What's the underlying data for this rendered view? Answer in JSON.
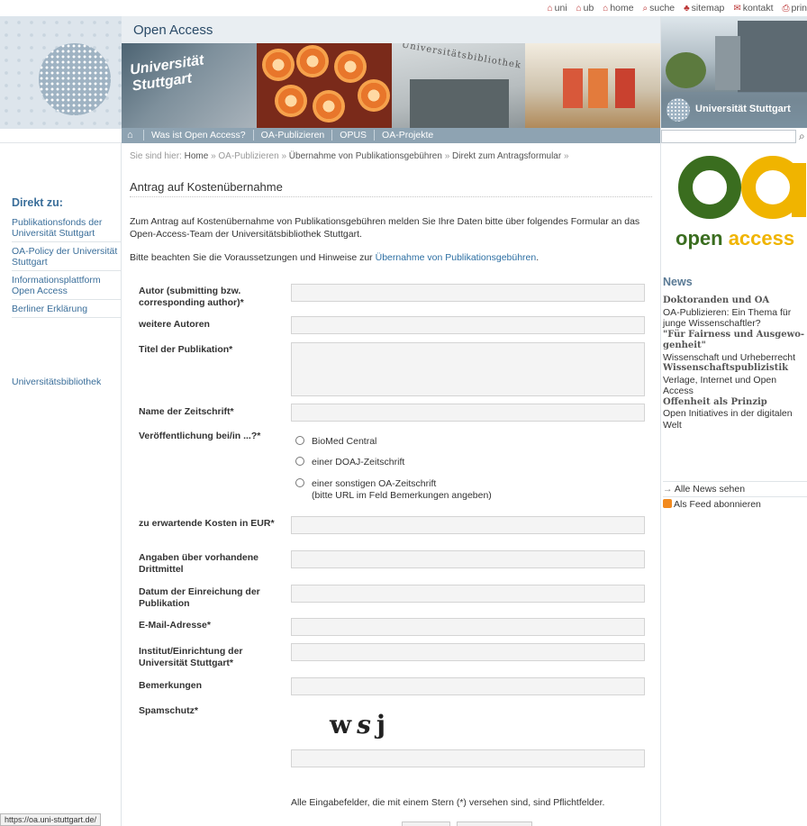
{
  "topbar": {
    "links": [
      {
        "icon": "home-icon",
        "label": "uni"
      },
      {
        "icon": "home-icon",
        "label": "ub"
      },
      {
        "icon": "home-icon",
        "label": "home"
      },
      {
        "icon": "search-icon",
        "label": "suche"
      },
      {
        "icon": "sitemap-icon",
        "label": "sitemap"
      },
      {
        "icon": "mail-icon",
        "label": "kontakt"
      },
      {
        "icon": "print-icon",
        "label": "prin"
      }
    ]
  },
  "header": {
    "title": "Open Access",
    "banner_text": "Universität Stuttgart",
    "banner_sign": "Universitätsbibliothek"
  },
  "nav": {
    "tabs": [
      "Was ist Open Access?",
      "OA-Publizieren",
      "OPUS",
      "OA-Projekte"
    ]
  },
  "breadcrumb": {
    "prefix": "Sie sind hier:",
    "items": [
      "Home",
      "OA-Publizieren",
      "Übernahme von Publikationsgebühren",
      "Direkt zum Antragsformular"
    ],
    "sep": "»"
  },
  "left": {
    "direkt_title": "Direkt zu:",
    "items": [
      "Publikationsfonds der Universität Stuttgart",
      "OA-Policy der Universität Stuttgart",
      "Informationsplattform Open Access",
      "Berliner Erklärung"
    ],
    "ub": "Universitätsbibliothek"
  },
  "main": {
    "title": "Antrag auf Kostenübernahme",
    "intro": "Zum Antrag auf Kostenübernahme von Publikationsgebühren melden Sie Ihre Daten bitte über folgendes Formular an das Open-Access-Team der Universitätsbibliothek Stuttgart.",
    "intro2_prefix": "Bitte beachten Sie die Voraussetzungen und Hinweise zur",
    "intro2_link": "Übernahme von Publikationsgebühren",
    "intro2_suffix": ".",
    "labels": {
      "autor": "Autor (submitting bzw. corresponding author)*",
      "weitere": "weitere Autoren",
      "titel": "Titel der Publikation*",
      "zeitschrift": "Name der Zeitschrift*",
      "veroeff": "Veröffentlichung bei/in ...?*",
      "kosten": "zu erwartende Kosten in EUR*",
      "drittmittel": "Angaben über vorhandene Drittmittel",
      "datum": "Datum der Einreichung der Publikation",
      "email": "E-Mail-Adresse*",
      "institut": "Institut/Einrichtung der Universität Stuttgart*",
      "bemerkungen": "Bemerkungen",
      "spam": "Spamschutz*"
    },
    "radios": [
      {
        "label": "BioMed Central",
        "checked": false
      },
      {
        "label": "einer DOAJ-Zeitschrift",
        "checked": false
      },
      {
        "label": "einer sonstigen OA-Zeitschrift",
        "sub": "(bitte URL im Feld Bemerkungen angeben)",
        "checked": false
      }
    ],
    "captcha": {
      "c1": "w",
      "c2": "s",
      "c3": "j"
    },
    "pflicht": "Alle Eingabefelder, die mit einem Stern (*) versehen sind, sind Pflichtfelder."
  },
  "right": {
    "photo_text": "Universität Stuttgart",
    "oa_open": "open",
    "oa_access": "access",
    "news_title": "News",
    "news": [
      {
        "text": "Doktoranden und OA",
        "bold": true
      },
      {
        "text": "OA-Publizieren: Ein Thema für",
        "bold": false
      },
      {
        "text": "junge Wissenschaftler?",
        "bold": false
      },
      {
        "text": "\"Für Fairness und Ausgewo-",
        "bold": true
      },
      {
        "text": "genheit\"",
        "bold": true
      },
      {
        "text": "Wissenschaft und Urheberrecht",
        "bold": false
      },
      {
        "text": "Wissenschaftspublizistik",
        "bold": true
      },
      {
        "text": "Verlage, Internet und Open",
        "bold": false
      },
      {
        "text": "Access",
        "bold": false
      },
      {
        "text": "Offenheit als Prinzip",
        "bold": true
      },
      {
        "text": "Open Initiatives in der digitalen",
        "bold": false
      },
      {
        "text": "Welt",
        "bold": false
      }
    ],
    "all_news": "Alle News sehen",
    "feed": "Als Feed abonnieren"
  },
  "status": {
    "url": "https://oa.uni-stuttgart.de/"
  },
  "colors": {
    "link": "#3a6e9a",
    "nav": "#8ea3b2",
    "oa_green": "#3a6d1f",
    "oa_yellow": "#f0b400"
  }
}
